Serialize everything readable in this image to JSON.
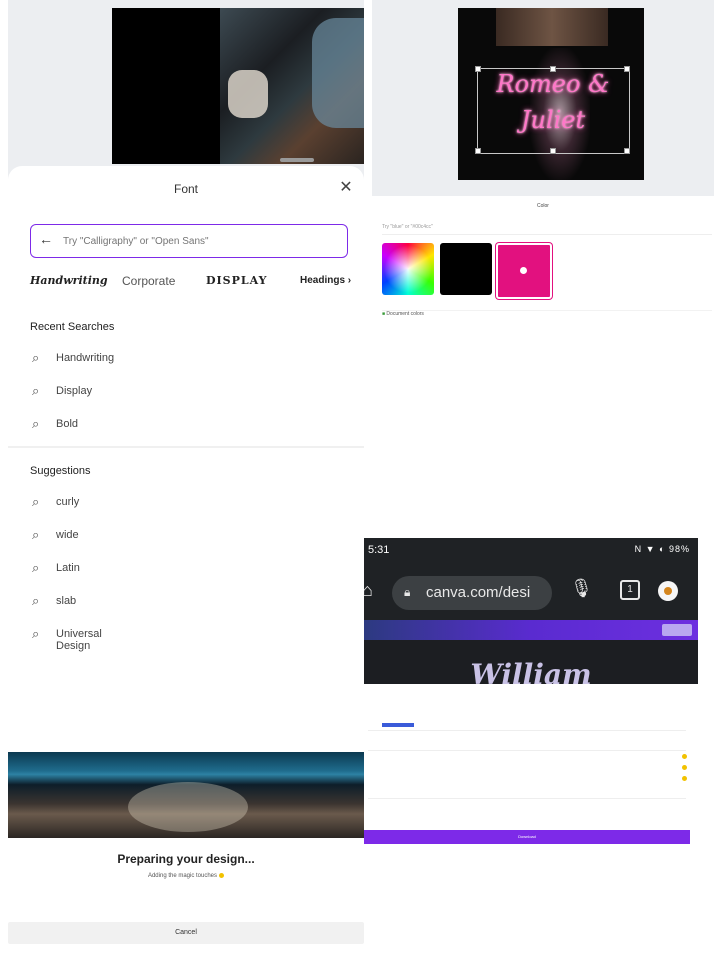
{
  "font_panel": {
    "title": "Font",
    "search_placeholder": "Try \"Calligraphy\" or \"Open Sans\"",
    "chips": [
      "Handwriting",
      "Corporate",
      "DISPLAY",
      "Headings"
    ],
    "recent_title": "Recent Searches",
    "recent": [
      "Handwriting",
      "Display",
      "Bold"
    ],
    "suggestions_title": "Suggestions",
    "suggestions": [
      "curly",
      "wide",
      "Latin",
      "slab",
      "Universal Design"
    ]
  },
  "preparing_panel": {
    "title": "Preparing your design...",
    "subtitle": "Adding the magic touches",
    "cancel_label": "Cancel"
  },
  "design_panel": {
    "design_text": "Romeo &\nJuliet",
    "color_label": "Color",
    "color_search_placeholder": "Try \"blue\" or \"#00c4cc\"",
    "swatches": [
      "#000000",
      "#e2117f"
    ],
    "footer_label": "Document colors"
  },
  "browser_panel": {
    "status_time": "5:31",
    "status_right": "N ▼ ◐ 98%",
    "url": "canva.com/desi",
    "design_text": "William",
    "download_label": "Download",
    "colors": {
      "canva_purple": "#7d2ae8",
      "selection_blue": "#3a5bd9"
    }
  }
}
